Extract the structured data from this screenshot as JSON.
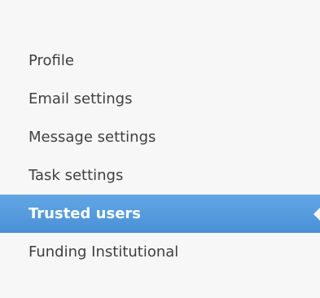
{
  "settings_nav": {
    "items": [
      {
        "label": "Profile",
        "active": false
      },
      {
        "label": "Email settings",
        "active": false
      },
      {
        "label": "Message settings",
        "active": false
      },
      {
        "label": "Task settings",
        "active": false
      },
      {
        "label": "Trusted users",
        "active": true
      },
      {
        "label": "Funding Institutional",
        "active": false
      }
    ]
  },
  "colors": {
    "active_background": "#4a90d7",
    "active_text": "#ffffff",
    "item_text": "#3f3f3f",
    "panel_background": "#f7f7f7"
  }
}
